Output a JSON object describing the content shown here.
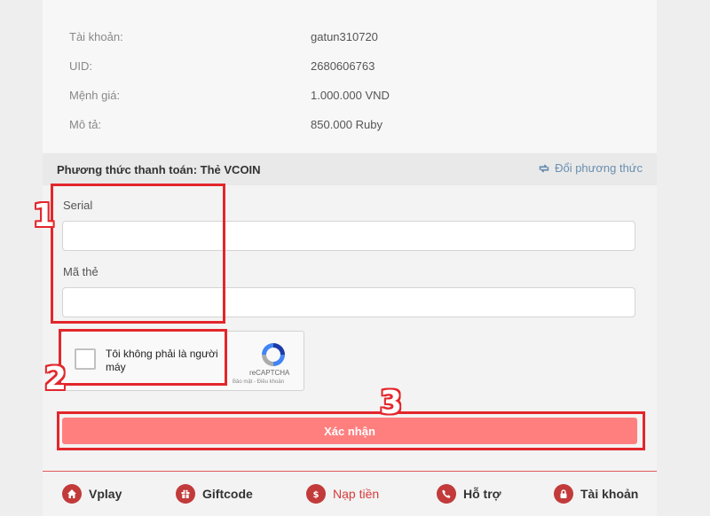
{
  "account_info": {
    "rows": [
      {
        "label": "Tài khoản:",
        "value": "gatun310720"
      },
      {
        "label": "UID:",
        "value": "2680606763"
      },
      {
        "label": "Mệnh giá:",
        "value": "1.000.000 VND"
      },
      {
        "label": "Mô tả:",
        "value": "850.000 Ruby"
      }
    ]
  },
  "payment": {
    "method_title": "Phương thức thanh toán: Thẻ VCOIN",
    "change_method_label": "Đổi phương thức"
  },
  "form": {
    "serial_label": "Serial",
    "serial_value": "",
    "card_code_label": "Mã thẻ",
    "card_code_value": ""
  },
  "captcha": {
    "text": "Tôi không phải là người máy",
    "brand": "reCAPTCHA",
    "terms": "Bảo mật - Điều khoản"
  },
  "submit_label": "Xác nhận",
  "footer_nav": [
    {
      "label": "Vplay",
      "icon": "home-icon"
    },
    {
      "label": "Giftcode",
      "icon": "gift-icon"
    },
    {
      "label": "Nạp tiền",
      "icon": "dollar-icon"
    },
    {
      "label": "Hỗ trợ",
      "icon": "phone-icon"
    },
    {
      "label": "Tài khoản",
      "icon": "lock-icon"
    }
  ],
  "annotations": [
    "1",
    "2",
    "3"
  ],
  "colors": {
    "accent": "#d63b3b",
    "button": "#ff7f7f",
    "highlight": "#e3262b"
  }
}
